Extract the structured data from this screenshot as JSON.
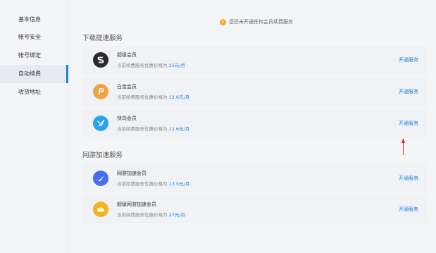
{
  "sidebar": {
    "items": [
      {
        "label": "基本信息",
        "active": false
      },
      {
        "label": "帐号安全",
        "active": false
      },
      {
        "label": "帐号绑定",
        "active": false
      },
      {
        "label": "自动续费",
        "active": true
      },
      {
        "label": "收货地址",
        "active": false
      }
    ]
  },
  "notice": {
    "icon": "warning-icon",
    "text": "您还未开通任何会员续费服务"
  },
  "sections": [
    {
      "title": "下载提速服务",
      "cards": [
        {
          "name": "超级会员",
          "desc_prefix": "当前续费服务优惠价格为 ",
          "price": "25元/月",
          "action": "开通服务",
          "icon": "svip-icon",
          "color": "#2b2b2b"
        },
        {
          "name": "白金会员",
          "desc_prefix": "当前续费服务优惠价格为 ",
          "price": "12.6元/月",
          "action": "开通服务",
          "icon": "platinum-icon",
          "color": "#f0a24a"
        },
        {
          "name": "快鸟会员",
          "desc_prefix": "当前续费服务优惠价格为 ",
          "price": "12.6元/月",
          "action": "开通服务",
          "icon": "kuainiao-icon",
          "color": "#2aa3ef"
        }
      ]
    },
    {
      "title": "网游加速服务",
      "cards": [
        {
          "name": "网游加速会员",
          "desc_prefix": "当前续费服务优惠价格为 ",
          "price": "13.5元/月",
          "action": "开通服务",
          "icon": "game-accel-icon",
          "color": "#4b6cf0"
        },
        {
          "name": "超级网游加速会员",
          "desc_prefix": "当前续费服务优惠价格为 ",
          "price": "27元/月",
          "action": "开通服务",
          "icon": "crown-icon",
          "color": "#f5b21f"
        }
      ]
    }
  ],
  "colors": {
    "accent": "#1e7fe0",
    "annotation_arrow": "#e02424"
  }
}
